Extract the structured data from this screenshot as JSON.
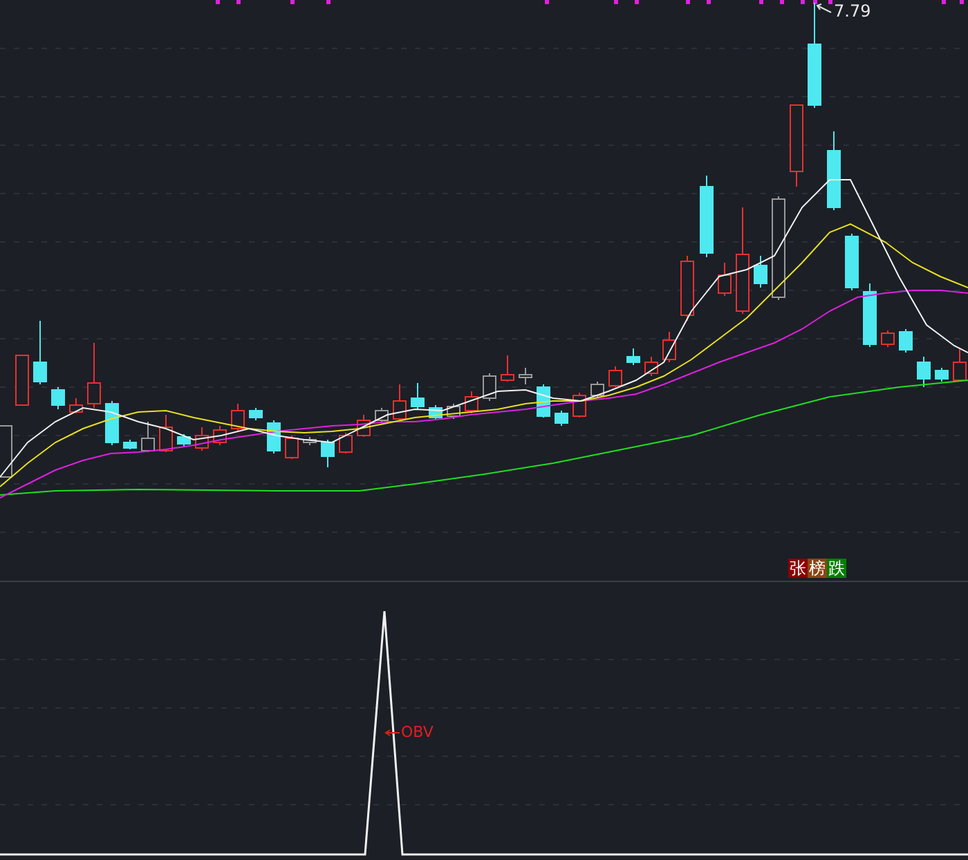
{
  "price_panel": {
    "peak_label": "7.79",
    "tags": [
      {
        "text": "张",
        "color": "#8b0000"
      },
      {
        "text": "榜",
        "color": "#8b4513"
      },
      {
        "text": "跌",
        "color": "#008000"
      }
    ]
  },
  "indicator_panel": {
    "name": "OBV"
  }
}
